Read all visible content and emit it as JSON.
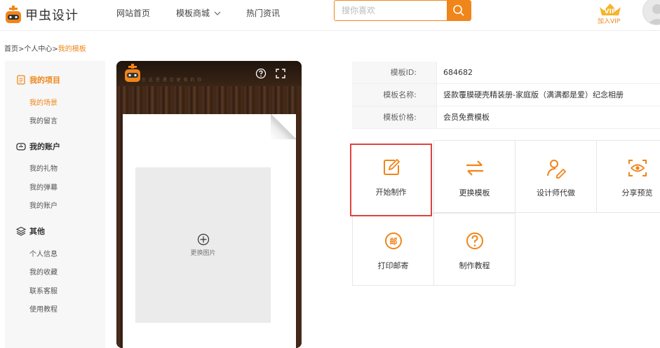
{
  "header": {
    "logo_text": "甲虫设计",
    "nav": [
      "网站首页",
      "模板商城",
      "热门资讯"
    ],
    "search_placeholder": "搜你喜欢",
    "vip_label": "加入VIP",
    "accent": "#f08519"
  },
  "breadcrumb": {
    "home": "首页",
    "sep1": ">",
    "center": "个人中心",
    "sep2": ">",
    "current": "我的模板"
  },
  "sidebar": {
    "sections": [
      {
        "title": "我的项目",
        "icon": "document-icon",
        "items": [
          "我的场景",
          "我的留言"
        ]
      },
      {
        "title": "我的账户",
        "icon": "wallet-icon",
        "items": [
          "我的礼物",
          "我的弹幕",
          "我的账户"
        ]
      },
      {
        "title": "其他",
        "icon": "layers-icon",
        "items": [
          "个人信息",
          "我的收藏",
          "联系客服",
          "使用教程"
        ]
      }
    ]
  },
  "preview": {
    "tagline": "在 这 里 遇 见 更 美 的 你",
    "image_label": "更换图片"
  },
  "info": {
    "rows": [
      {
        "key": "模板ID:",
        "value": "684682"
      },
      {
        "key": "模板名称:",
        "value": "竖款覆膜硬壳精装册-家庭版（满满都是爱）纪念相册"
      },
      {
        "key": "模板价格:",
        "value": "会员免费模板"
      }
    ]
  },
  "actions": [
    {
      "label": "开始制作",
      "icon": "edit-icon"
    },
    {
      "label": "更换模板",
      "icon": "swap-icon"
    },
    {
      "label": "设计师代做",
      "icon": "designer-icon"
    },
    {
      "label": "分享预览",
      "icon": "eye-icon"
    },
    {
      "label": "打印邮寄",
      "icon": "mail-icon"
    },
    {
      "label": "制作教程",
      "icon": "help-icon"
    }
  ],
  "colors": {
    "accent": "#f08519",
    "highlight": "#e0423f"
  }
}
